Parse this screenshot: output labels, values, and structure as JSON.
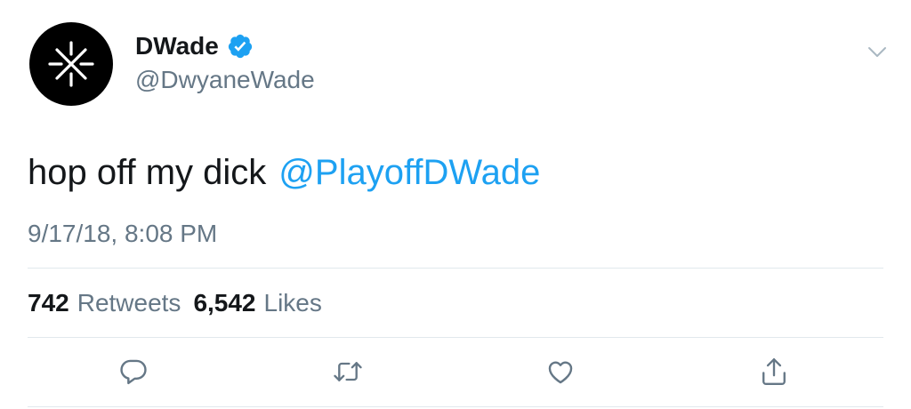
{
  "user": {
    "display_name": "DWade",
    "handle": "@DwyaneWade",
    "verified": true,
    "avatar_icon": "x-logo-icon"
  },
  "tweet": {
    "text": "hop off my dick",
    "mention": "@PlayoffDWade",
    "timestamp": "9/17/18, 8:08 PM"
  },
  "stats": {
    "retweets_count": "742",
    "retweets_label": "Retweets",
    "likes_count": "6,542",
    "likes_label": "Likes"
  },
  "actions": {
    "reply_icon": "reply-icon",
    "retweet_icon": "retweet-icon",
    "like_icon": "heart-icon",
    "share_icon": "share-icon"
  },
  "colors": {
    "link": "#1da1f2",
    "secondary_text": "#657786",
    "primary_text": "#14171a",
    "divider": "#e1e8ed",
    "verified": "#1da1f2"
  }
}
